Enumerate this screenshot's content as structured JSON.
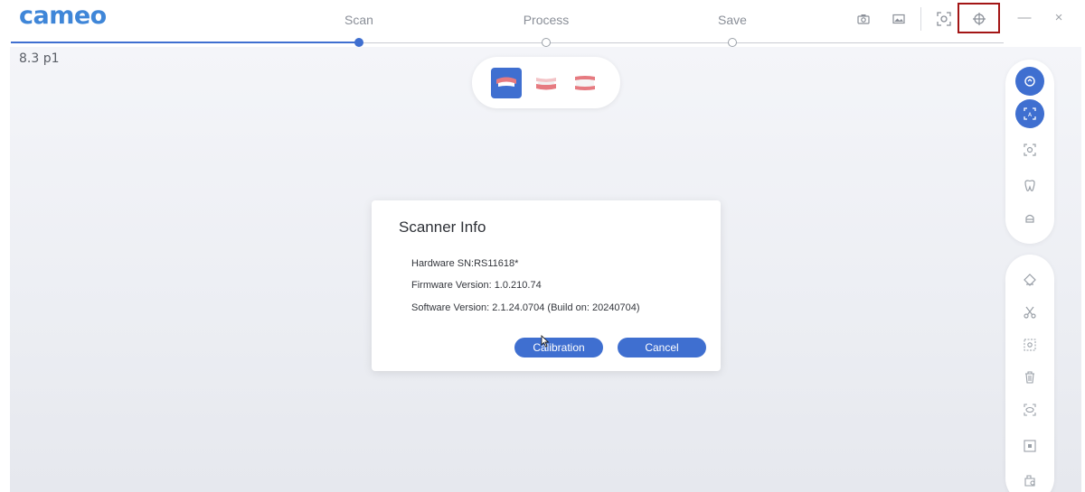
{
  "app": {
    "logo_text": "cameo",
    "version_label": "8.3 p1"
  },
  "steps": [
    {
      "label": "Scan",
      "state": "active"
    },
    {
      "label": "Process",
      "state": "pending"
    },
    {
      "label": "Save",
      "state": "pending"
    }
  ],
  "toolbar_icons": [
    "camera-icon",
    "image-icon",
    "scan-frame-icon",
    "target-icon"
  ],
  "window_controls": {
    "minimize": "—",
    "close": "×"
  },
  "jaw_selector": {
    "items": [
      "upper-jaw-icon",
      "lower-jaw-icon",
      "bite-icon"
    ],
    "selected": 0
  },
  "dialog": {
    "title": "Scanner Info",
    "hardware_sn": "Hardware SN:RS11618*",
    "firmware_version": "Firmware Version: 1.0.210.74",
    "software_version": "Software Version: 2.1.24.0704 (Build on: 20240704)",
    "calibration_label": "Calibration",
    "cancel_label": "Cancel"
  },
  "colors": {
    "accent": "#3f6fd0",
    "logo": "#3f86d8",
    "highlight": "#a31515"
  }
}
